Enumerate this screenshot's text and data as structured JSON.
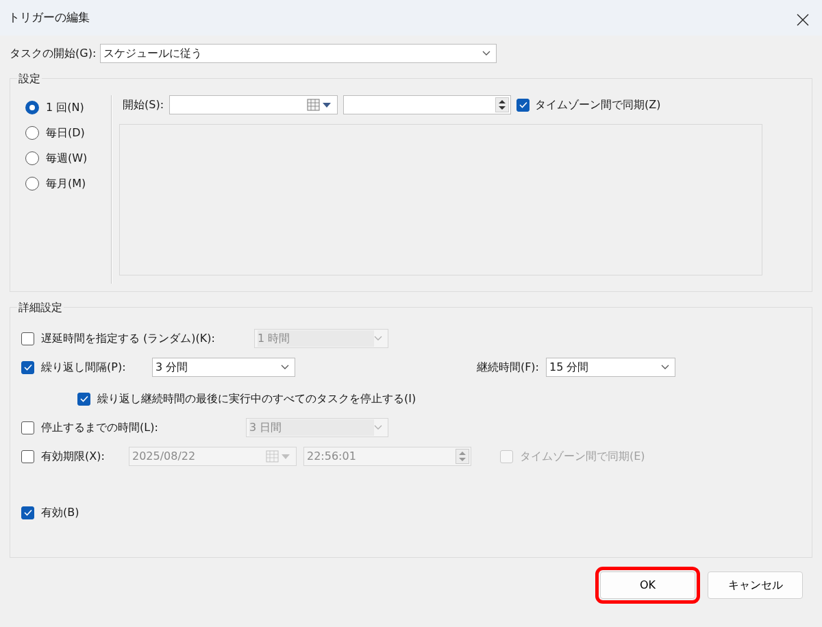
{
  "window": {
    "title": "トリガーの編集"
  },
  "task_start": {
    "label": "タスクの開始(G):",
    "value": "スケジュールに従う"
  },
  "settings": {
    "title": "設定",
    "schedule_options": [
      {
        "label": "1 回(N)",
        "selected": true
      },
      {
        "label": "毎日(D)",
        "selected": false
      },
      {
        "label": "毎週(W)",
        "selected": false
      },
      {
        "label": "毎月(M)",
        "selected": false
      }
    ],
    "start_label": "開始(S):",
    "sync": {
      "label": "タイムゾーン間で同期(Z)",
      "checked": true,
      "disabled": false
    }
  },
  "advanced": {
    "title": "詳細設定",
    "delay": {
      "label": "遅延時間を指定する (ランダム)(K):",
      "checked": false,
      "value": "1 時間",
      "disabled": true
    },
    "repeat": {
      "label": "繰り返し間隔(P):",
      "checked": true,
      "value": "3 分間",
      "disabled": false
    },
    "duration": {
      "label": "継続時間(F):",
      "value": "15 分間",
      "disabled": false
    },
    "stop_all": {
      "label": "繰り返し継続時間の最後に実行中のすべてのタスクを停止する(I)",
      "checked": true
    },
    "stop_after": {
      "label": "停止するまでの時間(L):",
      "checked": false,
      "value": "3 日間",
      "disabled": true
    },
    "expire": {
      "label": "有効期限(X):",
      "checked": false,
      "date": "2025/08/22",
      "time": "22:56:01",
      "disabled": true
    },
    "expire_sync": {
      "label": "タイムゾーン間で同期(E)",
      "checked": false,
      "disabled": true
    },
    "enabled": {
      "label": "有効(B)",
      "checked": true
    }
  },
  "buttons": [
    {
      "label": "OK",
      "highlighted": true
    },
    {
      "label": "キャンセル",
      "highlighted": false
    }
  ]
}
